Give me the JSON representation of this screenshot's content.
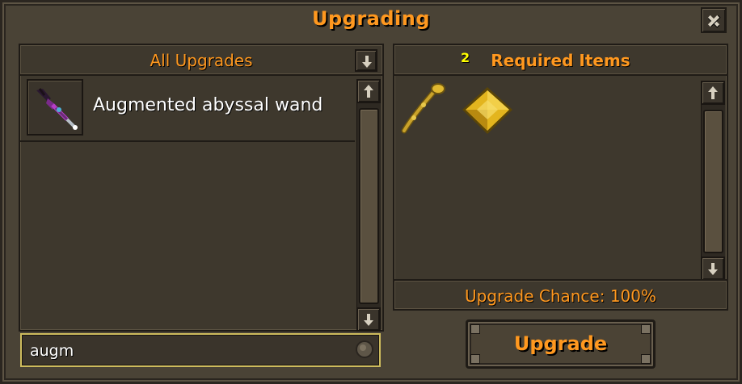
{
  "window": {
    "title": "Upgrading",
    "close_icon": "close-icon"
  },
  "left_panel": {
    "header": "All Upgrades",
    "sort_icon": "arrow-down-icon",
    "items": [
      {
        "name": "Augmented abyssal wand",
        "icon": "wand-icon"
      }
    ],
    "scroll_up_icon": "arrow-up-icon",
    "scroll_down_icon": "arrow-down-icon"
  },
  "search": {
    "value": "augm",
    "icon": "magnifier-icon"
  },
  "right_panel": {
    "header": "Required Items",
    "items": [
      {
        "icon": "staff-icon",
        "quantity": ""
      },
      {
        "icon": "gold-diamond-icon",
        "quantity": "2"
      }
    ],
    "chance": "Upgrade Chance: 100%",
    "scroll_up_icon": "arrow-up-icon",
    "scroll_down_icon": "arrow-down-icon"
  },
  "upgrade_button": {
    "label": "Upgrade"
  },
  "colors": {
    "accent": "#ff981f",
    "panel": "#3e382d",
    "frame": "#4a4336",
    "highlight_border": "#cdbb5d",
    "quantity": "#ffff00"
  }
}
